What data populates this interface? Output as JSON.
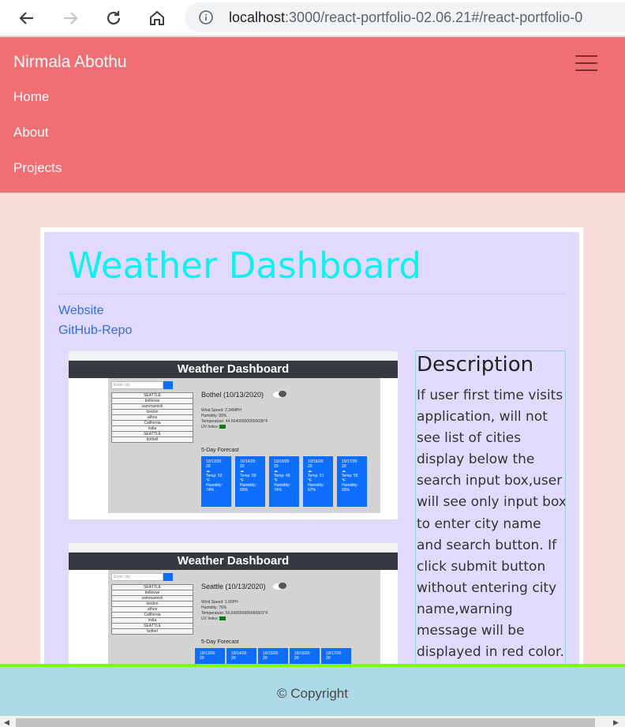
{
  "browser": {
    "url_host": "localhost",
    "url_rest": ":3000/react-portfolio-02.06.21#/react-portfolio-0"
  },
  "header": {
    "brand": "Nirmala Abothu",
    "nav": [
      "Home",
      "About",
      "Projects"
    ]
  },
  "project": {
    "title": "Weather Dashboard",
    "links": {
      "website": "Website",
      "repo": "GitHub-Repo"
    },
    "description_heading": "Description",
    "description": "If user first time visits application, will not see list of cities display below the search input box,user will see only input box to enter city name and search button. If click submit button without entering city name,warning message will be displayed in red color. If user is existing"
  },
  "screenshots": [
    {
      "header": "Weather Dashboard",
      "search_placeholder": "Enter city",
      "cities": [
        "SEATTLE",
        "bellevue",
        "sammamish",
        "london",
        "athos",
        "California",
        "india",
        "SEATTLE",
        "bothell"
      ],
      "city_title": "Bothel (10/13/2020)",
      "stats": [
        "Wind Speed: 2.34MPH",
        "Humidity: 99%",
        "Temperature: 44.564000000000036°F",
        "UV Index:"
      ],
      "forecast_label": "5-Day Forecast",
      "forecast": [
        {
          "date": "10/13/20 20",
          "temp": "Temp: 52 °F",
          "hum": "Humidity: 74%"
        },
        {
          "date": "10/14/20 20",
          "temp": "Temp: 50 °F",
          "hum": "Humidity: 65%"
        },
        {
          "date": "10/15/20 20",
          "temp": "Temp: 48 °F",
          "hum": "Humidity: 74%"
        },
        {
          "date": "10/16/20 20",
          "temp": "Temp: 51 °F",
          "hum": "Humidity: 67%"
        },
        {
          "date": "10/17/20 20",
          "temp": "Temp: 55 °F",
          "hum": "Humidity: 65%"
        }
      ]
    },
    {
      "header": "Weather Dashboard",
      "search_placeholder": "Enter city",
      "cities": [
        "SEATTLE",
        "bellevue",
        "sammamish",
        "london",
        "athos",
        "California",
        "india",
        "SEATTLE",
        "bothel"
      ],
      "city_title": "Seattle (10/13/2020)",
      "stats": [
        "Wind Speed: 1.06PH",
        "Humidity: 76%",
        "Temperature: 50.666666666666601°F",
        "UV Index:"
      ],
      "forecast_label": "5-Day Forecast",
      "forecast": [
        {
          "date": "10/13/20 20"
        },
        {
          "date": "10/14/20 20"
        },
        {
          "date": "10/15/20 20"
        },
        {
          "date": "10/16/20 20"
        },
        {
          "date": "10/17/20 20"
        }
      ]
    }
  ],
  "footer": {
    "text": "© Copyright"
  },
  "colors": {
    "header_bg": "#ef6f73",
    "page_bg": "#f8dbd7",
    "card_bg": "#e2dafd",
    "title": "#10f0ee",
    "link": "#2f6de0",
    "footer_bg": "#add8e6",
    "footer_border": "#7cfc00"
  }
}
